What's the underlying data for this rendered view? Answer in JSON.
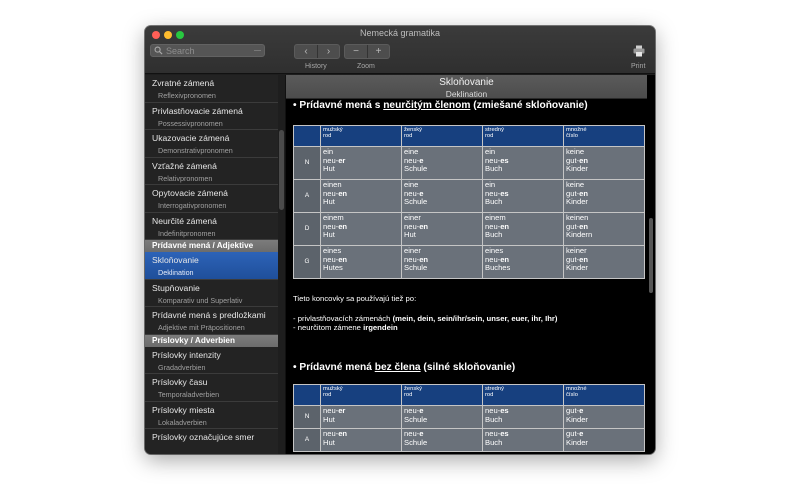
{
  "window": {
    "title": "Nemecká gramatika"
  },
  "toolbar": {
    "search_placeholder": "Search",
    "history_label": "History",
    "zoom_label": "Zoom",
    "zoom_out": "−",
    "zoom_in": "+",
    "print_label": "Print",
    "back": "‹",
    "forward": "›"
  },
  "sidebar": {
    "group1": [
      {
        "title": "Zvratné zámená",
        "subtitle": "Reflexivpronomen"
      },
      {
        "title": "Privlastňovacie zámená",
        "subtitle": "Possessivpronomen"
      },
      {
        "title": "Ukazovacie zámená",
        "subtitle": "Demonstrativpronomen"
      },
      {
        "title": "Vzťažné zámená",
        "subtitle": "Relativpronomen"
      },
      {
        "title": "Opytovacie zámená",
        "subtitle": "Interrogativpronomen"
      },
      {
        "title": "Neurčité zámená",
        "subtitle": "Indefinitpronomen"
      }
    ],
    "header2": "Prídavné mená / Adjektive",
    "group2": [
      {
        "title": "Skloňovanie",
        "subtitle": "Deklination"
      },
      {
        "title": "Stupňovanie",
        "subtitle": "Komparativ und Superlativ"
      },
      {
        "title": "Prídavné mená s predložkami",
        "subtitle": "Adjektive mit Präpositionen"
      }
    ],
    "header3": "Príslovky / Adverbien",
    "group3": [
      {
        "title": "Príslovky intenzity",
        "subtitle": "Gradadverbien"
      },
      {
        "title": "Príslovky času",
        "subtitle": "Temporaladverbien"
      },
      {
        "title": "Príslovky miesta",
        "subtitle": "Lokaladverbien"
      },
      {
        "title": "Príslovky označujúce smer",
        "subtitle": ""
      }
    ]
  },
  "content": {
    "title": "Skloňovanie",
    "subtitle": "Deklination",
    "section1": {
      "prefix": "• Prídavné mená s ",
      "underlined": "neurčitým členom",
      "suffix": " (zmiešané skloňovanie)"
    },
    "section2": {
      "prefix": "• Prídavné mená ",
      "underlined": "bez člena",
      "suffix": " (silné skloňovanie)"
    },
    "columns": [
      {
        "line1": "mužský",
        "line2": "rod"
      },
      {
        "line1": "ženský",
        "line2": "rod"
      },
      {
        "line1": "stredný",
        "line2": "rod"
      },
      {
        "line1": "množné",
        "line2": "číslo"
      }
    ],
    "table1": [
      {
        "case": "N",
        "cells": [
          {
            "l1": "ein",
            "l2a": "neu-",
            "l2b": "er",
            "l3": "Hut"
          },
          {
            "l1": "eine",
            "l2a": "neu-",
            "l2b": "e",
            "l3": "Schule"
          },
          {
            "l1": "ein",
            "l2a": "neu-",
            "l2b": "es",
            "l3": "Buch"
          },
          {
            "l1": "keine",
            "l2a": "gut-",
            "l2b": "en",
            "l3": "Kinder"
          }
        ]
      },
      {
        "case": "A",
        "cells": [
          {
            "l1": "einen",
            "l2a": "neu-",
            "l2b": "en",
            "l3": "Hut"
          },
          {
            "l1": "eine",
            "l2a": "neu-",
            "l2b": "e",
            "l3": "Schule"
          },
          {
            "l1": "ein",
            "l2a": "neu-",
            "l2b": "es",
            "l3": "Buch"
          },
          {
            "l1": "keine",
            "l2a": "gut-",
            "l2b": "en",
            "l3": "Kinder"
          }
        ]
      },
      {
        "case": "D",
        "cells": [
          {
            "l1": "einem",
            "l2a": "neu-",
            "l2b": "en",
            "l3": "Hut"
          },
          {
            "l1": "einer",
            "l2a": "neu-",
            "l2b": "en",
            "l3": "Hut"
          },
          {
            "l1": "einem",
            "l2a": "neu-",
            "l2b": "en",
            "l3": "Buch"
          },
          {
            "l1": "keinen",
            "l2a": "gut-",
            "l2b": "en",
            "l3": "Kindern"
          }
        ]
      },
      {
        "case": "G",
        "cells": [
          {
            "l1": "eines",
            "l2a": "neu-",
            "l2b": "en",
            "l3": "Hutes"
          },
          {
            "l1": "einer",
            "l2a": "neu-",
            "l2b": "en",
            "l3": "Schule"
          },
          {
            "l1": "eines",
            "l2a": "neu-",
            "l2b": "en",
            "l3": "Buches"
          },
          {
            "l1": "keiner",
            "l2a": "gut-",
            "l2b": "en",
            "l3": "Kinder"
          }
        ]
      }
    ],
    "note": {
      "intro": "Tieto koncovky sa používajú tiež po:",
      "line1_prefix": "- privlastňovacích zámenách ",
      "line1_bold": "(mein, dein, sein/ihr/sein, unser, euer, ihr, Ihr)",
      "line2_prefix": "- neurčitom zámene ",
      "line2_bold": "irgendein"
    },
    "table2": [
      {
        "case": "N",
        "cells": [
          {
            "l2a": "neu-",
            "l2b": "er",
            "l3": "Hut"
          },
          {
            "l2a": "neu-",
            "l2b": "e",
            "l3": "Schule"
          },
          {
            "l2a": "neu-",
            "l2b": "es",
            "l3": "Buch"
          },
          {
            "l2a": "gut-",
            "l2b": "e",
            "l3": "Kinder"
          }
        ]
      },
      {
        "case": "A",
        "cells": [
          {
            "l2a": "neu-",
            "l2b": "en",
            "l3": "Hut"
          },
          {
            "l2a": "neu-",
            "l2b": "e",
            "l3": "Schule"
          },
          {
            "l2a": "neu-",
            "l2b": "es",
            "l3": "Buch"
          },
          {
            "l2a": "gut-",
            "l2b": "e",
            "l3": "Kinder"
          }
        ]
      }
    ]
  }
}
